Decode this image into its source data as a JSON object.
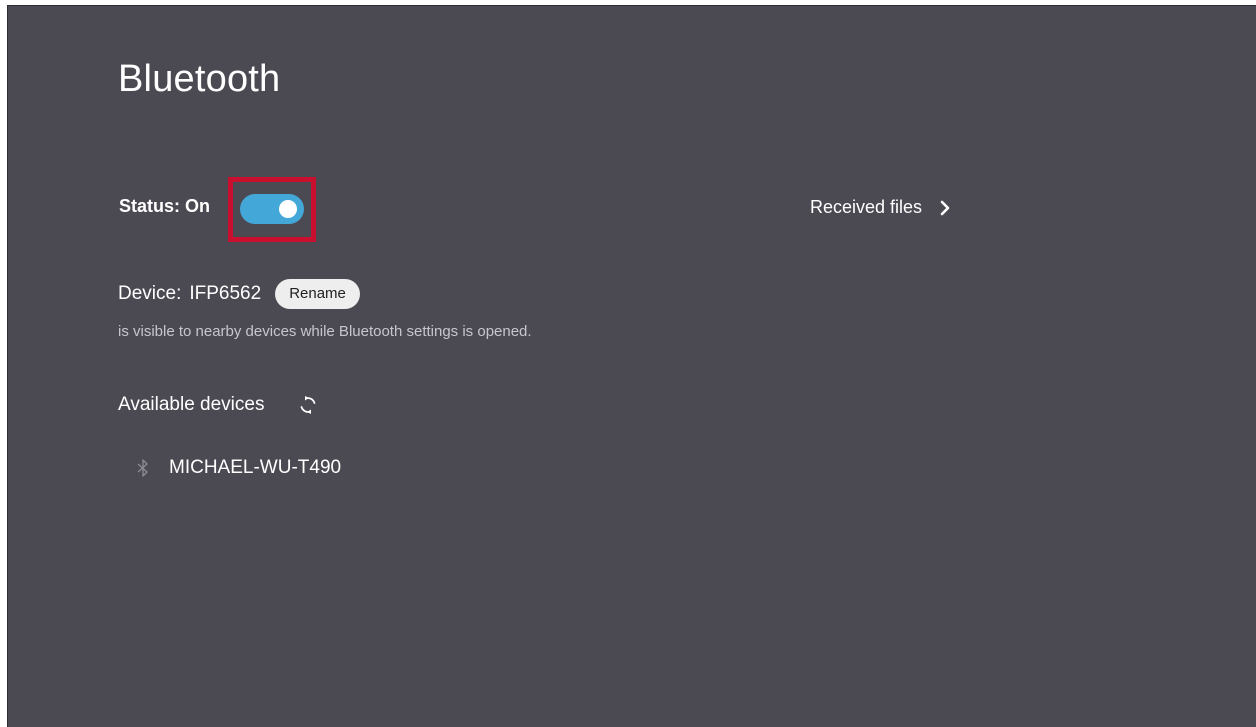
{
  "header": {
    "title": "Bluetooth"
  },
  "status": {
    "label": "Status: On",
    "toggle_on": true,
    "toggle_color": "#43a8d8",
    "highlight_color": "#c8102e"
  },
  "received_files": {
    "label": "Received files",
    "icon": "chevron-right-icon"
  },
  "device": {
    "label": "Device:",
    "name": "IFP6562",
    "rename_label": "Rename",
    "visibility_note": "is visible to nearby devices while Bluetooth settings is opened."
  },
  "available": {
    "label": "Available devices",
    "refresh_icon": "refresh-icon",
    "devices": [
      {
        "name": "MICHAEL-WU-T490",
        "icon": "bluetooth-icon"
      }
    ]
  },
  "colors": {
    "background": "#4b4a53",
    "text": "#ffffff",
    "muted_text": "#c7c6cd"
  }
}
